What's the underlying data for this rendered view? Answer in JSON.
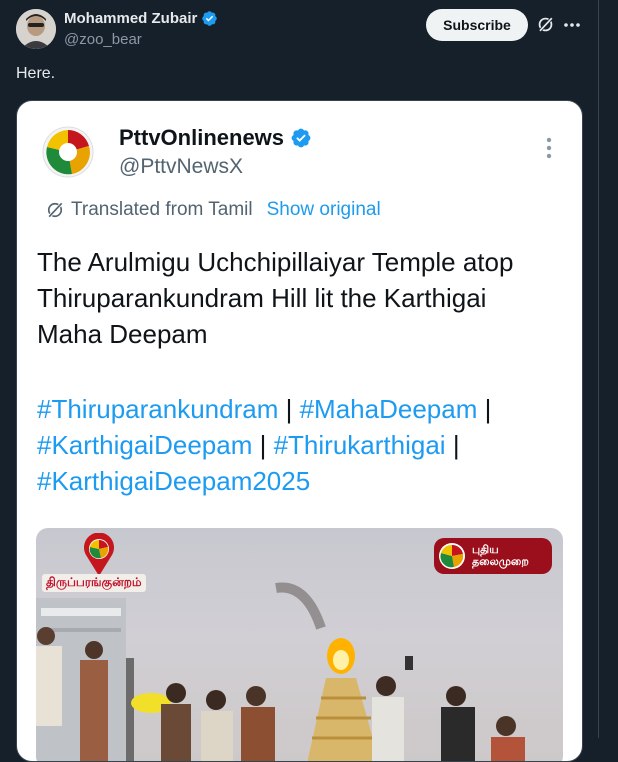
{
  "post": {
    "author_name": "Mohammed Zubair",
    "author_handle": "@zoo_bear",
    "subscribe_label": "Subscribe",
    "text": "Here."
  },
  "embedded": {
    "author_name": "PttvOnlinenews",
    "author_handle": "@PttvNewsX",
    "translated_label": "Translated from Tamil",
    "show_original_label": "Show original",
    "body": "The Arulmigu Uchchipillaiyar Temple atop Thiruparankundram Hill lit the Karthigai Maha Deepam",
    "hashtags": [
      "#Thiruparankundram",
      "#MahaDeepam",
      "#KarthigaiDeepam",
      "#Thirukarthigai",
      "#KarthigaiDeepam2025"
    ],
    "separator": "|",
    "photo": {
      "location_label": "திருப்பரங்குன்றம்",
      "channel_line1": "புதிய",
      "channel_line2": "தலைமுறை"
    }
  },
  "icons": [
    "verified-badge-icon",
    "grok-icon",
    "more-icon",
    "kebab-icon",
    "translate-icon",
    "location-pin-icon"
  ],
  "colors": {
    "background": "#15202b",
    "accent": "#1d9bf0",
    "subscribe_bg": "#eff3f4",
    "channel_red": "#9b0f1c"
  }
}
